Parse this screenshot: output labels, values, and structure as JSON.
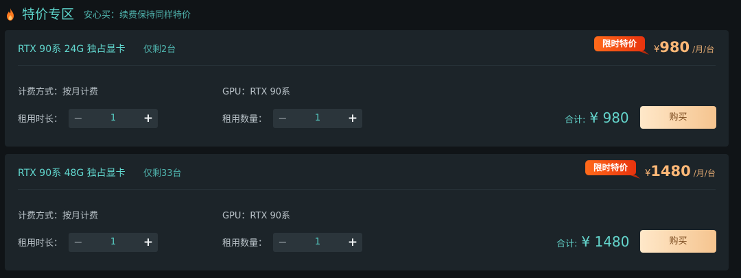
{
  "header": {
    "icon": "flame-icon",
    "title": "特价专区",
    "subtitle": "安心买：续费保持同样特价"
  },
  "colors": {
    "accent": "#5ed6cc",
    "price": "#ffb877",
    "badge_start": "#ff6a1a",
    "badge_end": "#e8330e",
    "buy_start": "#ffe8c9",
    "buy_end": "#f5c48f"
  },
  "cards": [
    {
      "title": "RTX 90系 24G 独占显卡",
      "remaining": "仅剩2台",
      "badge": "限时特价",
      "price_currency": "¥",
      "price_value": "980",
      "price_unit": "/月/台",
      "billing": "计费方式：按月计费",
      "gpu": "GPU：RTX 90系",
      "duration_label": "租用时长：",
      "duration_value": "1",
      "quantity_label": "租用数量：",
      "quantity_value": "1",
      "total_label": "合计:",
      "total_value": "¥ 980",
      "buy_label": "购买"
    },
    {
      "title": "RTX 90系 48G 独占显卡",
      "remaining": "仅剩33台",
      "badge": "限时特价",
      "price_currency": "¥",
      "price_value": "1480",
      "price_unit": "/月/台",
      "billing": "计费方式：按月计费",
      "gpu": "GPU：RTX 90系",
      "duration_label": "租用时长：",
      "duration_value": "1",
      "quantity_label": "租用数量：",
      "quantity_value": "1",
      "total_label": "合计:",
      "total_value": "¥ 1480",
      "buy_label": "购买"
    }
  ],
  "stepper": {
    "minus": "−",
    "plus": "+"
  }
}
